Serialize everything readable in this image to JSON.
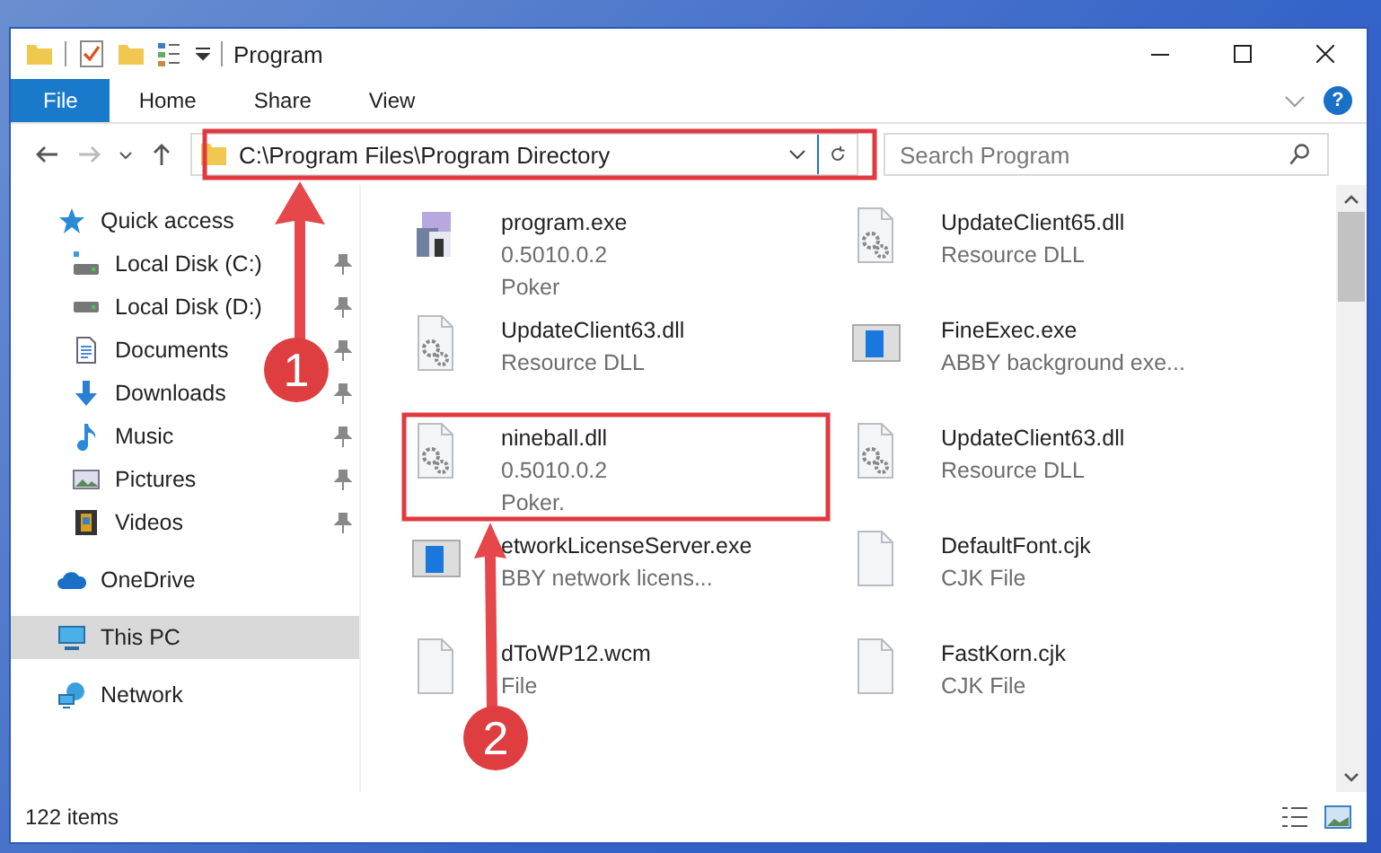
{
  "window": {
    "title": "Program"
  },
  "ribbon": {
    "tabs": [
      {
        "label": "File",
        "selected": true
      },
      {
        "label": "Home",
        "selected": false
      },
      {
        "label": "Share",
        "selected": false
      },
      {
        "label": "View",
        "selected": false
      }
    ],
    "help": "?"
  },
  "address": {
    "path": "C:\\Program Files\\Program Directory"
  },
  "search": {
    "placeholder": "Search Program"
  },
  "sidebar": {
    "items": [
      {
        "label": "Quick access",
        "kind": "star",
        "selected": false,
        "children": [
          {
            "label": "Local Disk (C:)",
            "kind": "system-drive",
            "pinned": true,
            "selected": false
          },
          {
            "label": "Local Disk (D:)",
            "kind": "drive",
            "pinned": true,
            "selected": false
          },
          {
            "label": "Documents",
            "kind": "document",
            "pinned": true,
            "selected": false
          },
          {
            "label": "Downloads",
            "kind": "download",
            "pinned": true,
            "selected": false
          },
          {
            "label": "Music",
            "kind": "music",
            "pinned": true,
            "selected": false
          },
          {
            "label": "Pictures",
            "kind": "pictures",
            "pinned": true,
            "selected": false
          },
          {
            "label": "Videos",
            "kind": "video",
            "pinned": true,
            "selected": false
          }
        ]
      },
      {
        "label": "OneDrive",
        "kind": "cloud",
        "selected": false
      },
      {
        "label": "This PC",
        "kind": "monitor",
        "selected": true
      },
      {
        "label": "Network",
        "kind": "network",
        "selected": false
      }
    ]
  },
  "files": [
    {
      "name": "program.exe",
      "details": [
        "0.5010.0.2",
        "Poker"
      ],
      "kind": "app"
    },
    {
      "name": "UpdateClient65.dll",
      "details": [
        "Resource DLL"
      ],
      "kind": "dll"
    },
    {
      "name": "UpdateClient63.dll",
      "details": [
        "Resource DLL"
      ],
      "kind": "dll"
    },
    {
      "name": "FineExec.exe",
      "details": [
        "ABBY background exe..."
      ],
      "kind": "window"
    },
    {
      "name": "nineball.dll",
      "details": [
        "0.5010.0.2",
        "Poker."
      ],
      "kind": "dll"
    },
    {
      "name": "UpdateClient63.dll",
      "details": [
        "Resource DLL"
      ],
      "kind": "dll"
    },
    {
      "name": "etworkLicenseServer.exe",
      "details": [
        "BBY network licens..."
      ],
      "kind": "window"
    },
    {
      "name": "DefaultFont.cjk",
      "details": [
        "CJK File"
      ],
      "kind": "file"
    },
    {
      "name": "dToWP12.wcm",
      "details": [
        "File"
      ],
      "kind": "file"
    },
    {
      "name": "FastKorn.cjk",
      "details": [
        "CJK File"
      ],
      "kind": "file"
    }
  ],
  "status_bar": {
    "count": "122 items"
  },
  "annotations": [
    {
      "number": "1"
    },
    {
      "number": "2"
    }
  ]
}
